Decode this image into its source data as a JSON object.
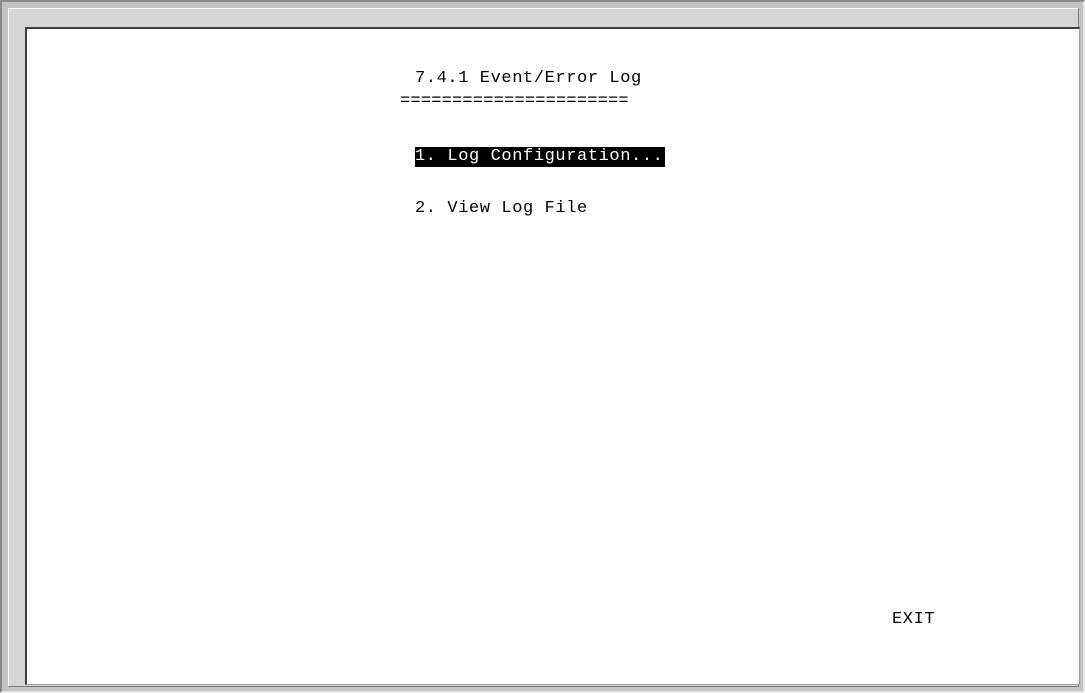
{
  "screen": {
    "title": "7.4.1 Event/Error Log",
    "title_underline": "======================",
    "menu_items": [
      {
        "label": "1. Log Configuration...",
        "selected": true
      },
      {
        "label": "2. View Log File",
        "selected": false
      }
    ],
    "exit_label": "EXIT"
  },
  "colors": {
    "frame": "#c4c4c4",
    "screen_background": "#ffffff",
    "text": "#000000",
    "highlight_background": "#000000",
    "highlight_text": "#ffffff"
  }
}
